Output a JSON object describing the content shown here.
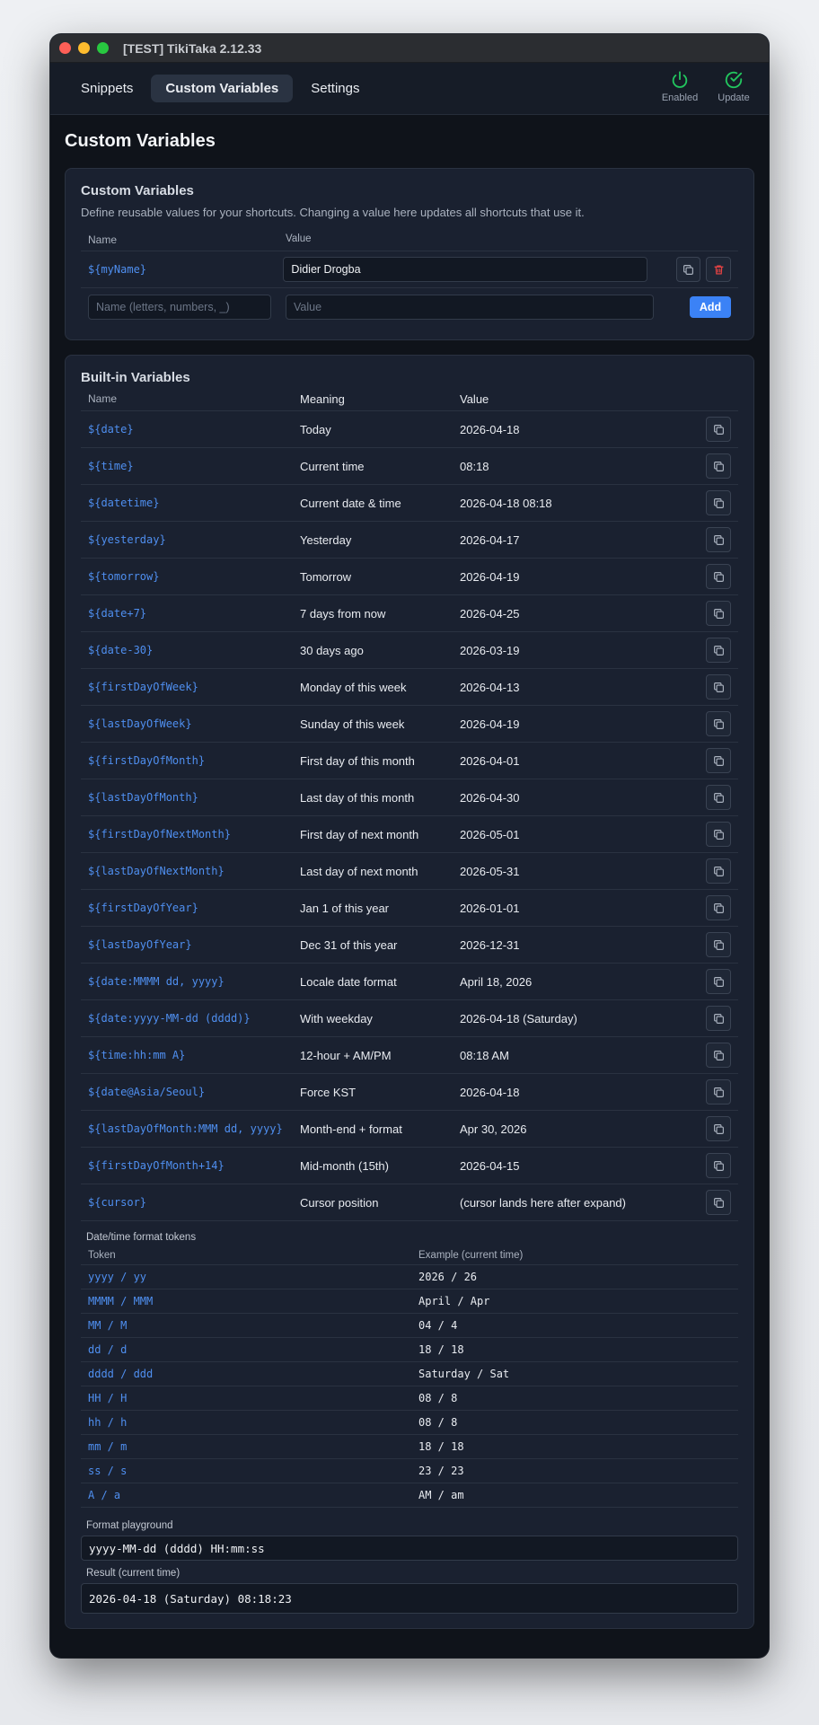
{
  "window": {
    "title": "[TEST] TikiTaka 2.12.33"
  },
  "nav": {
    "tabs": [
      "Snippets",
      "Custom Variables",
      "Settings"
    ],
    "active": "Custom Variables",
    "enabled_label": "Enabled",
    "update_label": "Update"
  },
  "page": {
    "title": "Custom Variables"
  },
  "custom": {
    "title": "Custom Variables",
    "description": "Define reusable values for your shortcuts. Changing a value here updates all shortcuts that use it.",
    "col_name": "Name",
    "col_value": "Value",
    "rows": [
      {
        "name": "${myName}",
        "value": "Didier Drogba"
      }
    ],
    "name_placeholder": "Name (letters, numbers, _)",
    "value_placeholder": "Value",
    "add_label": "Add"
  },
  "builtin": {
    "title": "Built-in Variables",
    "col_name": "Name",
    "col_meaning": "Meaning",
    "col_value": "Value",
    "rows": [
      {
        "name": "${date}",
        "meaning": "Today",
        "value": "2026-04-18"
      },
      {
        "name": "${time}",
        "meaning": "Current time",
        "value": "08:18"
      },
      {
        "name": "${datetime}",
        "meaning": "Current date & time",
        "value": "2026-04-18 08:18"
      },
      {
        "name": "${yesterday}",
        "meaning": "Yesterday",
        "value": "2026-04-17"
      },
      {
        "name": "${tomorrow}",
        "meaning": "Tomorrow",
        "value": "2026-04-19"
      },
      {
        "name": "${date+7}",
        "meaning": "7 days from now",
        "value": "2026-04-25"
      },
      {
        "name": "${date-30}",
        "meaning": "30 days ago",
        "value": "2026-03-19"
      },
      {
        "name": "${firstDayOfWeek}",
        "meaning": "Monday of this week",
        "value": "2026-04-13"
      },
      {
        "name": "${lastDayOfWeek}",
        "meaning": "Sunday of this week",
        "value": "2026-04-19"
      },
      {
        "name": "${firstDayOfMonth}",
        "meaning": "First day of this month",
        "value": "2026-04-01"
      },
      {
        "name": "${lastDayOfMonth}",
        "meaning": "Last day of this month",
        "value": "2026-04-30"
      },
      {
        "name": "${firstDayOfNextMonth}",
        "meaning": "First day of next month",
        "value": "2026-05-01"
      },
      {
        "name": "${lastDayOfNextMonth}",
        "meaning": "Last day of next month",
        "value": "2026-05-31"
      },
      {
        "name": "${firstDayOfYear}",
        "meaning": "Jan 1 of this year",
        "value": "2026-01-01"
      },
      {
        "name": "${lastDayOfYear}",
        "meaning": "Dec 31 of this year",
        "value": "2026-12-31"
      },
      {
        "name": "${date:MMMM dd, yyyy}",
        "meaning": "Locale date format",
        "value": "April 18, 2026"
      },
      {
        "name": "${date:yyyy-MM-dd (dddd)}",
        "meaning": "With weekday",
        "value": "2026-04-18 (Saturday)"
      },
      {
        "name": "${time:hh:mm A}",
        "meaning": "12-hour + AM/PM",
        "value": "08:18 AM"
      },
      {
        "name": "${date@Asia/Seoul}",
        "meaning": "Force KST",
        "value": "2026-04-18"
      },
      {
        "name": "${lastDayOfMonth:MMM dd, yyyy}",
        "meaning": "Month-end + format",
        "value": "Apr 30, 2026"
      },
      {
        "name": "${firstDayOfMonth+14}",
        "meaning": "Mid-month (15th)",
        "value": "2026-04-15"
      },
      {
        "name": "${cursor}",
        "meaning": "Cursor position",
        "value": "(cursor lands here after expand)"
      }
    ]
  },
  "tokens": {
    "title": "Date/time format tokens",
    "col_token": "Token",
    "col_example": "Example (current time)",
    "rows": [
      {
        "token": "yyyy / yy",
        "example": "2026 / 26"
      },
      {
        "token": "MMMM / MMM",
        "example": "April / Apr"
      },
      {
        "token": "MM / M",
        "example": "04 / 4"
      },
      {
        "token": "dd / d",
        "example": "18 / 18"
      },
      {
        "token": "dddd / ddd",
        "example": "Saturday / Sat"
      },
      {
        "token": "HH / H",
        "example": "08 / 8"
      },
      {
        "token": "hh / h",
        "example": "08 / 8"
      },
      {
        "token": "mm / m",
        "example": "18 / 18"
      },
      {
        "token": "ss / s",
        "example": "23 / 23"
      },
      {
        "token": "A / a",
        "example": "AM / am"
      }
    ]
  },
  "playground": {
    "label": "Format playground",
    "format": "yyyy-MM-dd (dddd) HH:mm:ss",
    "result_label": "Result (current time)",
    "result": "2026-04-18 (Saturday) 08:18:23"
  },
  "colors": {
    "accent": "#3b82f6",
    "link": "#4f8ff0",
    "success": "#22c55e",
    "danger": "#ef4444"
  }
}
